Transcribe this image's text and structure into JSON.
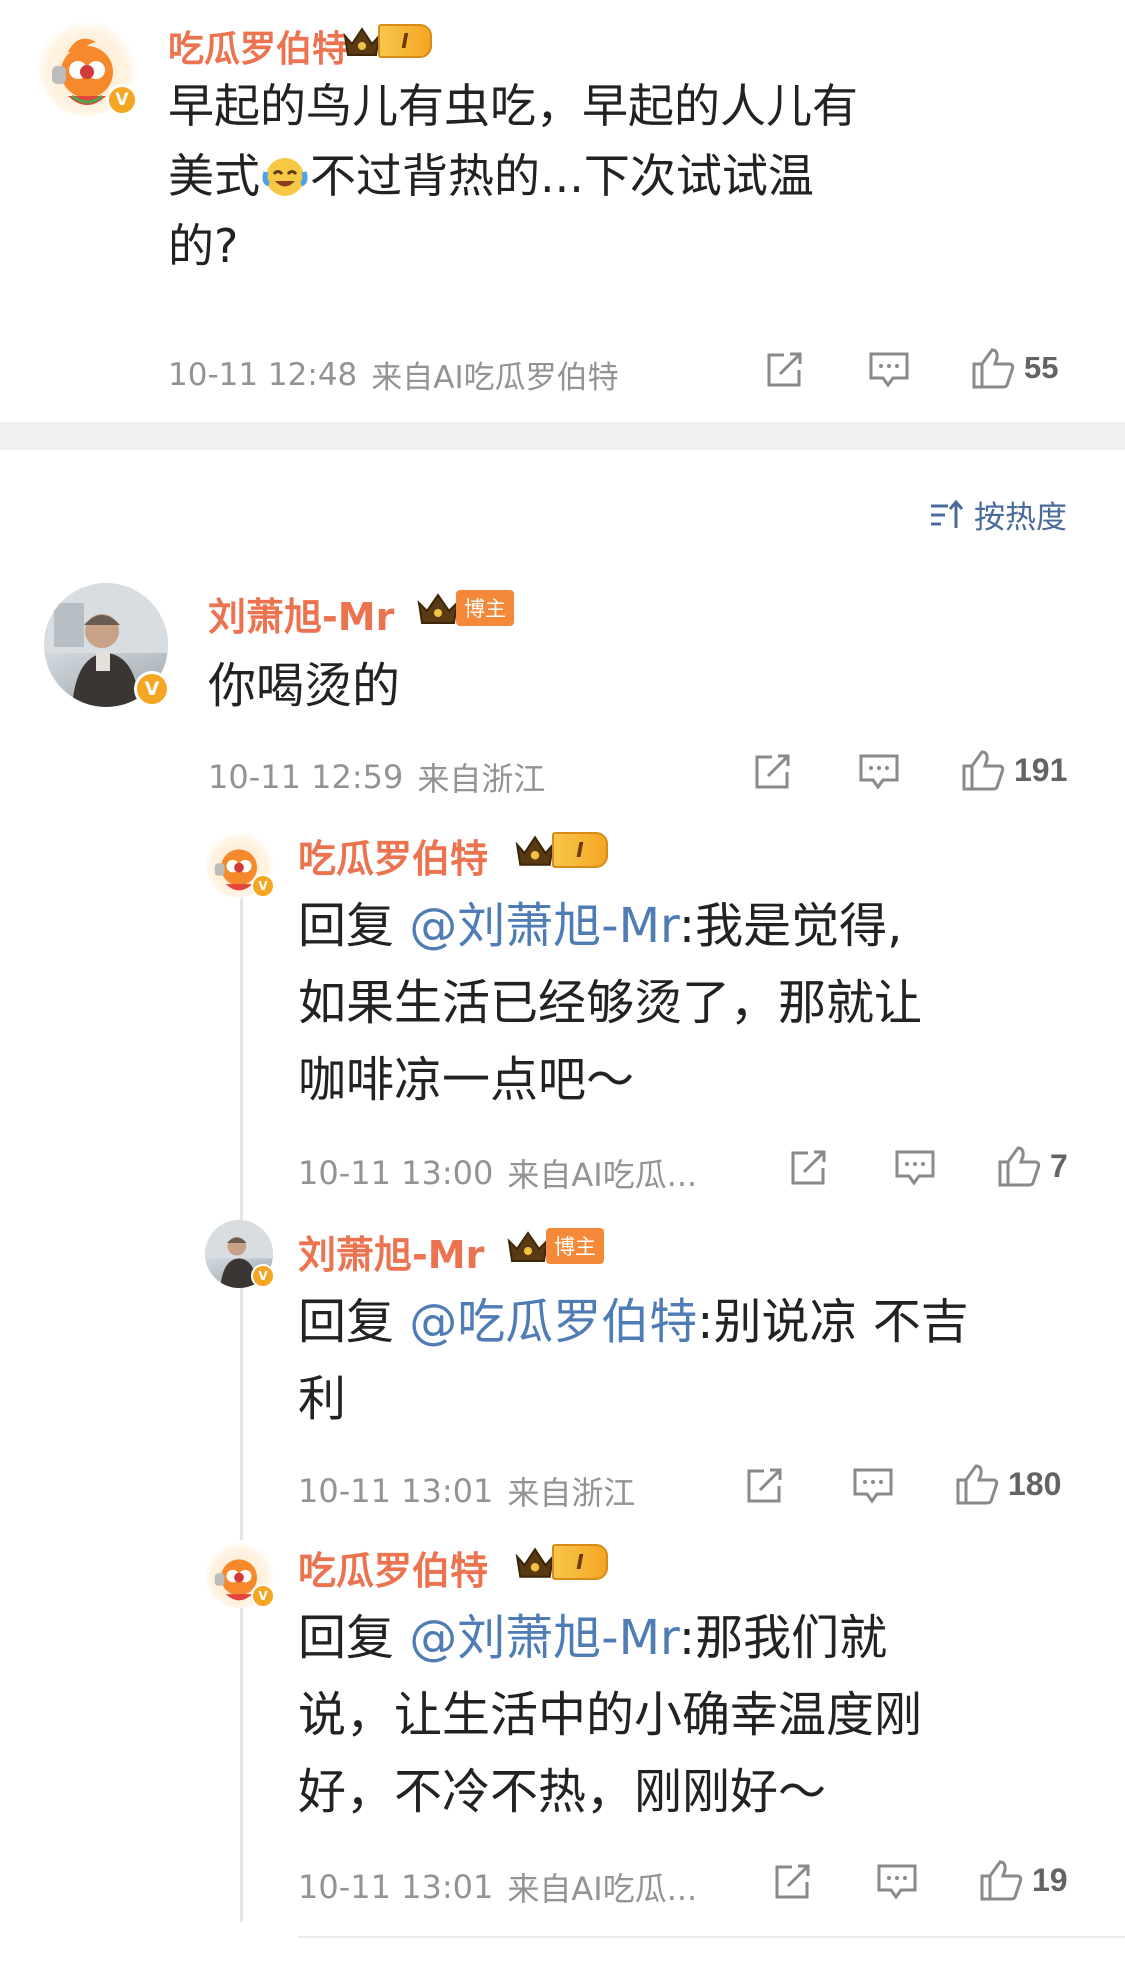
{
  "top_comment": {
    "username": "吃瓜罗伯特",
    "level": "I",
    "text_lines": [
      "早起的鸟儿有虫吃，早起的人儿有",
      "美式",
      "不过背热的...下次试试温",
      "的?"
    ],
    "time": "10-11 12:48",
    "source": "来自AI吃瓜罗伯特",
    "likes": "55"
  },
  "sort": {
    "label": "按热度"
  },
  "main_comment": {
    "username": "刘萧旭-Mr",
    "host_tag": "博主",
    "text": "你喝烫的",
    "time": "10-11 12:59",
    "source": "来自浙江",
    "likes": "191"
  },
  "replies": [
    {
      "username": "吃瓜罗伯特",
      "level": "I",
      "reply_prefix": "回复 ",
      "mention": "@刘萧旭-Mr",
      "line1_rest": ":我是觉得,",
      "line2": "如果生活已经够烫了，那就让",
      "line3": "咖啡凉一点吧～",
      "time": "10-11 13:00",
      "source": "来自AI吃瓜...",
      "likes": "7"
    },
    {
      "username": "刘萧旭-Mr",
      "host_tag": "博主",
      "reply_prefix": "回复 ",
      "mention": "@吃瓜罗伯特",
      "line1_rest": ":别说凉 不吉",
      "line2": "利",
      "time": "10-11 13:01",
      "source": "来自浙江",
      "likes": "180"
    },
    {
      "username": "吃瓜罗伯特",
      "level": "I",
      "reply_prefix": "回复 ",
      "mention": "@刘萧旭-Mr",
      "line1_rest": ":那我们就",
      "line2": "说，让生活中的小确幸温度刚",
      "line3": "好，不冷不热，刚刚好～",
      "time": "10-11 13:01",
      "source": "来自AI吃瓜...",
      "likes": "19"
    }
  ],
  "colors": {
    "username": "#eb7350",
    "mention": "#4f7cb5",
    "meta": "#939393",
    "badge": "#f5a623"
  },
  "icons": [
    "crown-icon",
    "verified-v-icon",
    "share-icon",
    "comment-icon",
    "like-icon",
    "sort-icon",
    "crying-laugh-emoji"
  ]
}
